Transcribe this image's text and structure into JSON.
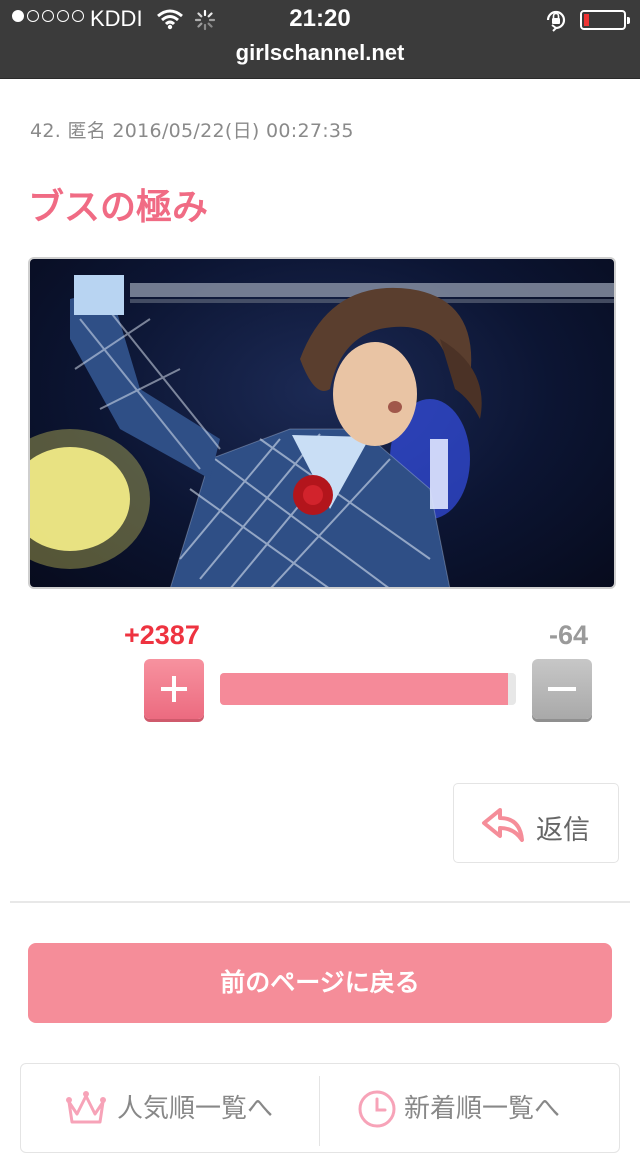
{
  "status_bar": {
    "carrier": "KDDI",
    "time": "21:20"
  },
  "url_bar": {
    "domain": "girlschannel.net"
  },
  "comment": {
    "meta": "42. 匿名 2016/05/22(日) 00:27:35",
    "title": "ブスの極み",
    "photo_icon": "photo-icon"
  },
  "votes": {
    "plus_label": "+2387",
    "minus_label": "-64",
    "plus_ratio": 0.974
  },
  "reply": {
    "label": "返信",
    "icon": "reply-arrow-icon"
  },
  "back_button": {
    "label": "前のページに戻る"
  },
  "list_nav": {
    "popular_label": "人気順一覧へ",
    "popular_icon": "crown-icon",
    "newest_label": "新着順一覧へ",
    "newest_icon": "clock-icon"
  },
  "colors": {
    "accent_pink": "#f58d99",
    "title_pink": "#f06b84",
    "plus_red": "#ee3340",
    "status_bar": "#3b3b3b"
  }
}
